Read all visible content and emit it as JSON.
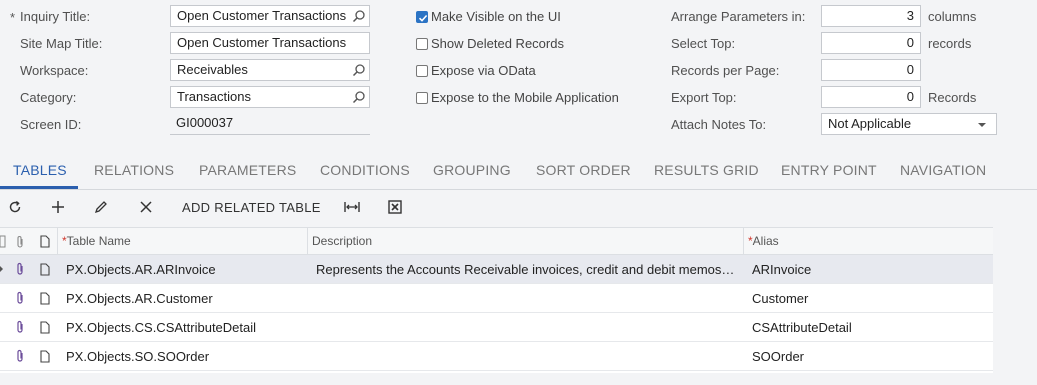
{
  "form": {
    "inquiry_title": {
      "required_mark": "*",
      "label": "Inquiry Title:",
      "value": "Open Customer Transactions"
    },
    "site_map_title": {
      "label": "Site Map Title:",
      "value": "Open Customer Transactions"
    },
    "workspace": {
      "label": "Workspace:",
      "value": "Receivables"
    },
    "category": {
      "label": "Category:",
      "value": "Transactions"
    },
    "screen_id": {
      "label": "Screen ID:",
      "value": "GI000037"
    }
  },
  "options": {
    "make_visible": {
      "label": "Make Visible on the UI",
      "checked": true
    },
    "show_deleted": {
      "label": "Show Deleted Records",
      "checked": false
    },
    "expose_odata": {
      "label": "Expose via OData",
      "checked": false
    },
    "expose_mobile": {
      "label": "Expose to the Mobile Application",
      "checked": false
    }
  },
  "params": {
    "arrange": {
      "label": "Arrange Parameters in:",
      "value": "3",
      "suffix": "columns"
    },
    "select_top": {
      "label": "Select Top:",
      "value": "0",
      "suffix": "records"
    },
    "records_per_page": {
      "label": "Records per Page:",
      "value": "0"
    },
    "export_top": {
      "label": "Export Top:",
      "value": "0",
      "suffix": "Records"
    },
    "attach_notes": {
      "label": "Attach Notes To:",
      "value": "Not Applicable"
    }
  },
  "tabs": [
    {
      "label": "TABLES",
      "active": true
    },
    {
      "label": "RELATIONS",
      "active": false
    },
    {
      "label": "PARAMETERS",
      "active": false
    },
    {
      "label": "CONDITIONS",
      "active": false
    },
    {
      "label": "GROUPING",
      "active": false
    },
    {
      "label": "SORT ORDER",
      "active": false
    },
    {
      "label": "RESULTS GRID",
      "active": false
    },
    {
      "label": "ENTRY POINT",
      "active": false
    },
    {
      "label": "NAVIGATION",
      "active": false
    }
  ],
  "toolbar": {
    "refresh_icon": "refresh-icon",
    "add_icon": "plus-icon",
    "edit_icon": "pencil-icon",
    "delete_icon": "x-icon",
    "add_related_label": "ADD RELATED TABLE",
    "fit_icon": "fit-columns-icon",
    "export_icon": "excel-icon"
  },
  "grid": {
    "headers": {
      "table_name": "Table Name",
      "description": "Description",
      "alias": "Alias",
      "required_mark": "*"
    },
    "rows": [
      {
        "table_name": "PX.Objects.AR.ARInvoice",
        "description": "Represents the Accounts Receivable invoices, credit and debit memos…",
        "alias": "ARInvoice",
        "selected": true
      },
      {
        "table_name": "PX.Objects.AR.Customer",
        "description": "",
        "alias": "Customer",
        "selected": false
      },
      {
        "table_name": "PX.Objects.CS.CSAttributeDetail",
        "description": "",
        "alias": "CSAttributeDetail",
        "selected": false
      },
      {
        "table_name": "PX.Objects.SO.SOOrder",
        "description": "",
        "alias": "SOOrder",
        "selected": false
      }
    ]
  },
  "colors": {
    "accent": "#2b5fae",
    "checkbox": "#2b73c4",
    "required": "#d0392e",
    "selected_row": "#e7e9ef"
  }
}
